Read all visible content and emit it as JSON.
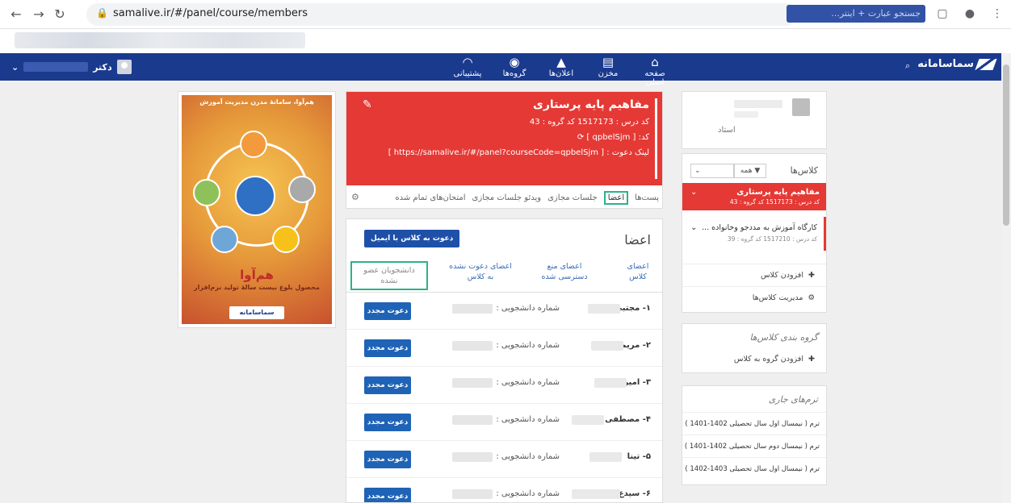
{
  "browser": {
    "url": "samalive.ir/#/panel/course/members"
  },
  "appbar": {
    "brand": "سماسامانه",
    "search_placeholder": "جستجو عبارت + اینتر...",
    "nav": [
      {
        "label": "صفحه اصلی",
        "icon": "home-icon"
      },
      {
        "label": "مخزن",
        "icon": "book-icon"
      },
      {
        "label": "اعلان‌ها",
        "icon": "bell-icon"
      },
      {
        "label": "گروه‌ها",
        "icon": "groups-icon"
      },
      {
        "label": "پشتیبانی",
        "icon": "rss-icon"
      }
    ],
    "user_prefix": "دکتر"
  },
  "promo": {
    "top": "هم‌آوا، سامانهٔ مدرن مدیریت آموزش",
    "title": "هم‌آوا",
    "subtitle": "محصول بلوغ بیست سالهٔ تولید نرم‌افزار",
    "logo": "سماسامانه"
  },
  "course": {
    "title": "مفاهیم پایه پرستاری",
    "code_line": "کد درس : 1517173   کد گروه : 43",
    "code": "کد: [ qpbelSjm ]",
    "invite_link": "لینک دعوت : [ https://samalive.ir/#/panel?courseCode=qpbelSjm ]",
    "tabs": [
      "پست‌ها",
      "اعضا",
      "جلسات مجازی",
      "ویدئو جلسات مجازی",
      "امتحان‌های تمام شده"
    ]
  },
  "members": {
    "title": "اعضا",
    "invite_email": "دعوت به کلاس با ایمیل",
    "tabs": [
      "اعضای کلاس",
      "اعضای منع دسترسی شده",
      "اعضای دعوت نشده به کلاس",
      "دانشجویان عضو نشده"
    ],
    "student_label": "شماره دانشجویی :",
    "reinvite": "دعوت مجدد",
    "rows": [
      {
        "name": "۱- مجتبی"
      },
      {
        "name": "۲- مریم"
      },
      {
        "name": "۳- امیر"
      },
      {
        "name": "۴- مصطفی د"
      },
      {
        "name": "۵- تینا"
      },
      {
        "name": "۶- سیدع"
      }
    ]
  },
  "sidebar": {
    "teacher_label": "استاد",
    "classes_title": "کلاس‌ها",
    "filter_label": "همه",
    "class_items": [
      {
        "title": "مفاهیم پایه پرستاری",
        "sub": "کد درس : 1517173   کد گروه : 43"
      },
      {
        "title": "کارگاه آموزش به مددجو وخانواده ...",
        "sub": "کد درس : 1517210   کد گروه : 39"
      }
    ],
    "add_class": "افزودن کلاس",
    "manage_classes": "مدیریت کلاس‌ها",
    "groups_title": "گروه بندی کلاس‌ها",
    "add_group": "افزودن گروه به کلاس",
    "terms_title": "ترم‌های جاری",
    "terms": [
      "ترم ( نیمسال اول سال تحصیلی 1402-1401 )",
      "ترم ( نیمسال دوم سال تحصیلی 1402-1401 )",
      "ترم ( نیمسال اول سال تحصیلی 1403-1402 )"
    ]
  }
}
